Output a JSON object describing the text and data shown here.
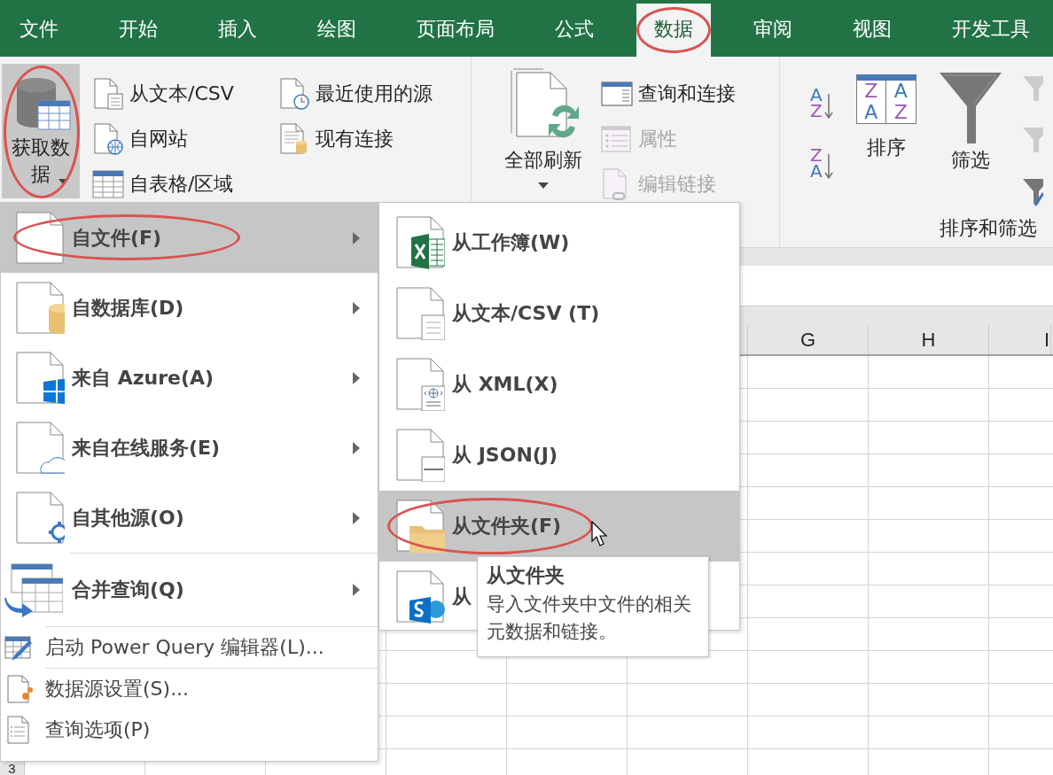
{
  "tabs": [
    {
      "label": "文件",
      "selected": false,
      "circled": false
    },
    {
      "label": "开始",
      "selected": false,
      "circled": false
    },
    {
      "label": "插入",
      "selected": false,
      "circled": false
    },
    {
      "label": "绘图",
      "selected": false,
      "circled": false
    },
    {
      "label": "页面布局",
      "selected": false,
      "circled": false
    },
    {
      "label": "公式",
      "selected": false,
      "circled": false
    },
    {
      "label": "数据",
      "selected": true,
      "circled": true
    },
    {
      "label": "审阅",
      "selected": false,
      "circled": false
    },
    {
      "label": "视图",
      "selected": false,
      "circled": false
    },
    {
      "label": "开发工具",
      "selected": false,
      "circled": false
    }
  ],
  "ribbon": {
    "get_data": {
      "label": "获取数据",
      "pressed": true,
      "circled": true
    },
    "import_items": [
      {
        "label": "从文本/CSV"
      },
      {
        "label": "自网站"
      },
      {
        "label": "自表格/区域"
      },
      {
        "label": "最近使用的源"
      },
      {
        "label": "现有连接"
      }
    ],
    "refresh_all": {
      "label": "全部刷新"
    },
    "query_items": [
      {
        "label": "查询和连接",
        "disabled": false
      },
      {
        "label": "属性",
        "disabled": true
      },
      {
        "label": "编辑链接",
        "disabled": true
      }
    ],
    "sort_buttons": [
      {
        "top": "A",
        "bottom": "Z"
      },
      {
        "top": "Z",
        "bottom": "A"
      }
    ],
    "sort": {
      "label": "排序",
      "letters": [
        "Z",
        "A",
        "A",
        "Z"
      ]
    },
    "filter": {
      "label": "筛选"
    },
    "group_label": "排序和筛选"
  },
  "sheet": {
    "columns": [
      "G",
      "H",
      "I"
    ],
    "row_numbers": [
      "3"
    ]
  },
  "menu": {
    "items": [
      {
        "kind": "submenu",
        "label": "自文件(F)",
        "selected": true,
        "circled": true,
        "separator": false
      },
      {
        "kind": "submenu",
        "label": "自数据库(D)",
        "selected": false,
        "circled": false,
        "separator": false
      },
      {
        "kind": "submenu",
        "label": "来自 Azure(A)",
        "selected": false,
        "circled": false,
        "separator": false
      },
      {
        "kind": "submenu",
        "label": "来自在线服务(E)",
        "selected": false,
        "circled": false,
        "separator": false
      },
      {
        "kind": "submenu",
        "label": "自其他源(O)",
        "selected": false,
        "circled": false,
        "separator": false
      },
      {
        "kind": "submenu",
        "label": "合并查询(Q)",
        "selected": false,
        "circled": false,
        "separator": true
      },
      {
        "kind": "command",
        "label": "启动 Power Query 编辑器(L)...",
        "selected": false,
        "circled": false,
        "separator": true
      },
      {
        "kind": "command",
        "label": "数据源设置(S)...",
        "selected": false,
        "circled": false,
        "separator": true
      },
      {
        "kind": "command",
        "label": "查询选项(P)",
        "selected": false,
        "circled": false,
        "separator": false
      }
    ]
  },
  "submenu": {
    "items": [
      {
        "label": "从工作簿(W)",
        "selected": false,
        "circled": false
      },
      {
        "label": "从文本/CSV (T)",
        "selected": false,
        "circled": false
      },
      {
        "label": "从 XML(X)",
        "selected": false,
        "circled": false
      },
      {
        "label": "从 JSON(J)",
        "selected": false,
        "circled": false
      },
      {
        "label": "从文件夹(F)",
        "selected": true,
        "circled": true
      },
      {
        "label": "从",
        "selected": false,
        "circled": false
      }
    ]
  },
  "tooltip": {
    "title": "从文件夹",
    "text": "导入文件夹中文件的相关元数据和链接。"
  }
}
